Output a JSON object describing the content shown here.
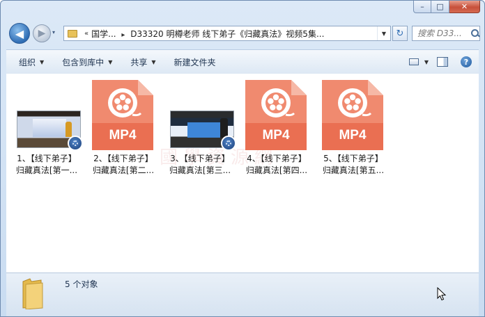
{
  "window": {
    "caption": {
      "minimize": "–",
      "maximize": "□",
      "close": "✕"
    }
  },
  "nav": {
    "back_label": "◀",
    "forward_label": "▶",
    "history_label": "▾",
    "breadcrumb_chevron": "«",
    "breadcrumb": [
      "国学...",
      "D33320 明樽老师 线下弟子《归藏真法》视频5集..."
    ],
    "breadcrumb_sep": "▸",
    "address_dropdown": "▼",
    "refresh_label": "↻",
    "search_placeholder": "搜索 D33..."
  },
  "toolbar": {
    "organize": "组织",
    "include_in_library": "包含到库中",
    "share": "共享",
    "new_folder": "新建文件夹",
    "dropdown_arrow": "▼",
    "help": "?"
  },
  "files": [
    {
      "line1": "1、【线下弟子】",
      "line2": "归藏真法[第一...",
      "type": "video-thumb"
    },
    {
      "line1": "2、【线下弟子】",
      "line2": "归藏真法[第二...",
      "type": "mp4-icon",
      "icon_text": "MP4"
    },
    {
      "line1": "3、【线下弟子】",
      "line2": "归藏真法[第三...",
      "type": "video-thumb"
    },
    {
      "line1": "4、【线下弟子】",
      "line2": "归藏真法[第四...",
      "type": "mp4-icon",
      "icon_text": "MP4"
    },
    {
      "line1": "5、【线下弟子】",
      "line2": "归藏真法[第五...",
      "type": "mp4-icon",
      "icon_text": "MP4"
    }
  ],
  "watermark": "國學資源網",
  "details": {
    "item_count": "5 个对象"
  },
  "colors": {
    "mp4_body": "#f08a6f",
    "accent": "#2f6db4"
  }
}
